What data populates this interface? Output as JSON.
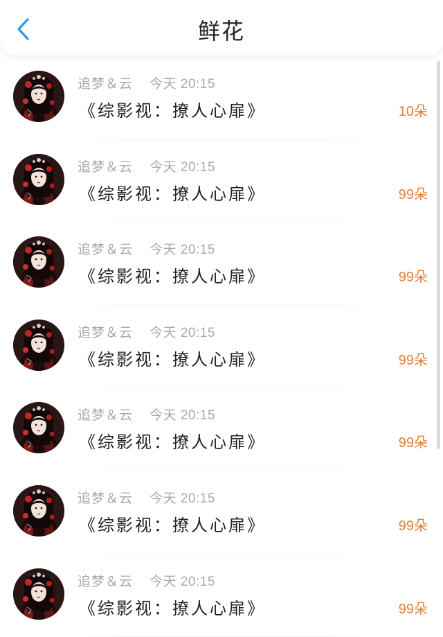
{
  "header": {
    "title": "鲜花",
    "back_icon": "chevron-left-icon",
    "accent_color": "#2f98f0"
  },
  "colors": {
    "amount": "#e3813b",
    "meta": "#a9a9a9",
    "text": "#222222"
  },
  "records": [
    {
      "user": "追梦＆云",
      "day": "今天",
      "time": "20:15",
      "book": "《综影视：撩人心扉》",
      "amount": "10",
      "unit": "朵"
    },
    {
      "user": "追梦＆云",
      "day": "今天",
      "time": "20:15",
      "book": "《综影视：撩人心扉》",
      "amount": "99",
      "unit": "朵"
    },
    {
      "user": "追梦＆云",
      "day": "今天",
      "time": "20:15",
      "book": "《综影视：撩人心扉》",
      "amount": "99",
      "unit": "朵"
    },
    {
      "user": "追梦＆云",
      "day": "今天",
      "time": "20:15",
      "book": "《综影视：撩人心扉》",
      "amount": "99",
      "unit": "朵"
    },
    {
      "user": "追梦＆云",
      "day": "今天",
      "time": "20:15",
      "book": "《综影视：撩人心扉》",
      "amount": "99",
      "unit": "朵"
    },
    {
      "user": "追梦＆云",
      "day": "今天",
      "time": "20:15",
      "book": "《综影视：撩人心扉》",
      "amount": "99",
      "unit": "朵"
    },
    {
      "user": "追梦＆云",
      "day": "今天",
      "time": "20:15",
      "book": "《综影视：撩人心扉》",
      "amount": "99",
      "unit": "朵"
    }
  ]
}
